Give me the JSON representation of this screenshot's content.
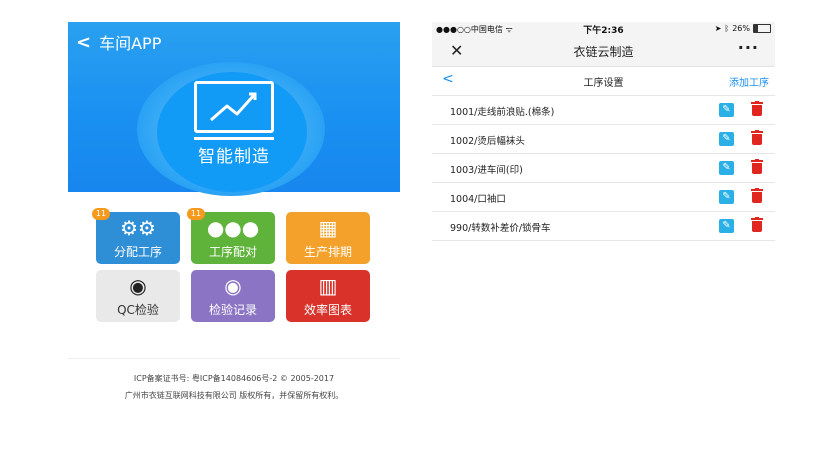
{
  "left_app": {
    "header": {
      "back_icon": "chevron-left-icon",
      "title": "车间APP"
    },
    "hero": {
      "logo_icon": "line-chart-monitor-icon",
      "title": "智能制造"
    },
    "tiles": [
      {
        "label": "分配工序",
        "icon": "gears-icon",
        "badge": "11",
        "color": "#2f8fd6"
      },
      {
        "label": "工序配对",
        "icon": "users-icon",
        "badge": "11",
        "color": "#5fb33b"
      },
      {
        "label": "生产排期",
        "icon": "building-icon",
        "badge": "",
        "color": "#f4a12b"
      },
      {
        "label": "QC检验",
        "icon": "eye-icon",
        "badge": "",
        "color": "#e9e9e9"
      },
      {
        "label": "检验记录",
        "icon": "eye-icon",
        "badge": "",
        "color": "#8b74c4"
      },
      {
        "label": "效率图表",
        "icon": "bar-chart-icon",
        "badge": "",
        "color": "#d9322b"
      }
    ],
    "footer": {
      "icp_line": "ICP备案证书号: 粤ICP备14084606号-2 © 2005-2017",
      "company_line": "广州市衣链互联网科技有限公司 版权所有，并保留所有权利。"
    }
  },
  "right_app": {
    "status_bar": {
      "carrier": "●●●○○中国电信 ",
      "wifi_icon": "wifi-icon",
      "time": "下午2:36",
      "battery_pct": "26%",
      "battery_level": 0.26
    },
    "nav": {
      "close_icon": "close-icon",
      "title": "衣链云制造",
      "more_icon": "more-icon",
      "more": "···"
    },
    "subheader": {
      "back": "<",
      "title": "工序设置",
      "add": "添加工序"
    },
    "rows": [
      {
        "text": "1001/走线前浪贴.(棉条)"
      },
      {
        "text": "1002/烫后幅袜头"
      },
      {
        "text": "1003/进车间(印)"
      },
      {
        "text": "1004/口袖口"
      },
      {
        "text": "990/转数补差价/锁骨车"
      }
    ]
  }
}
